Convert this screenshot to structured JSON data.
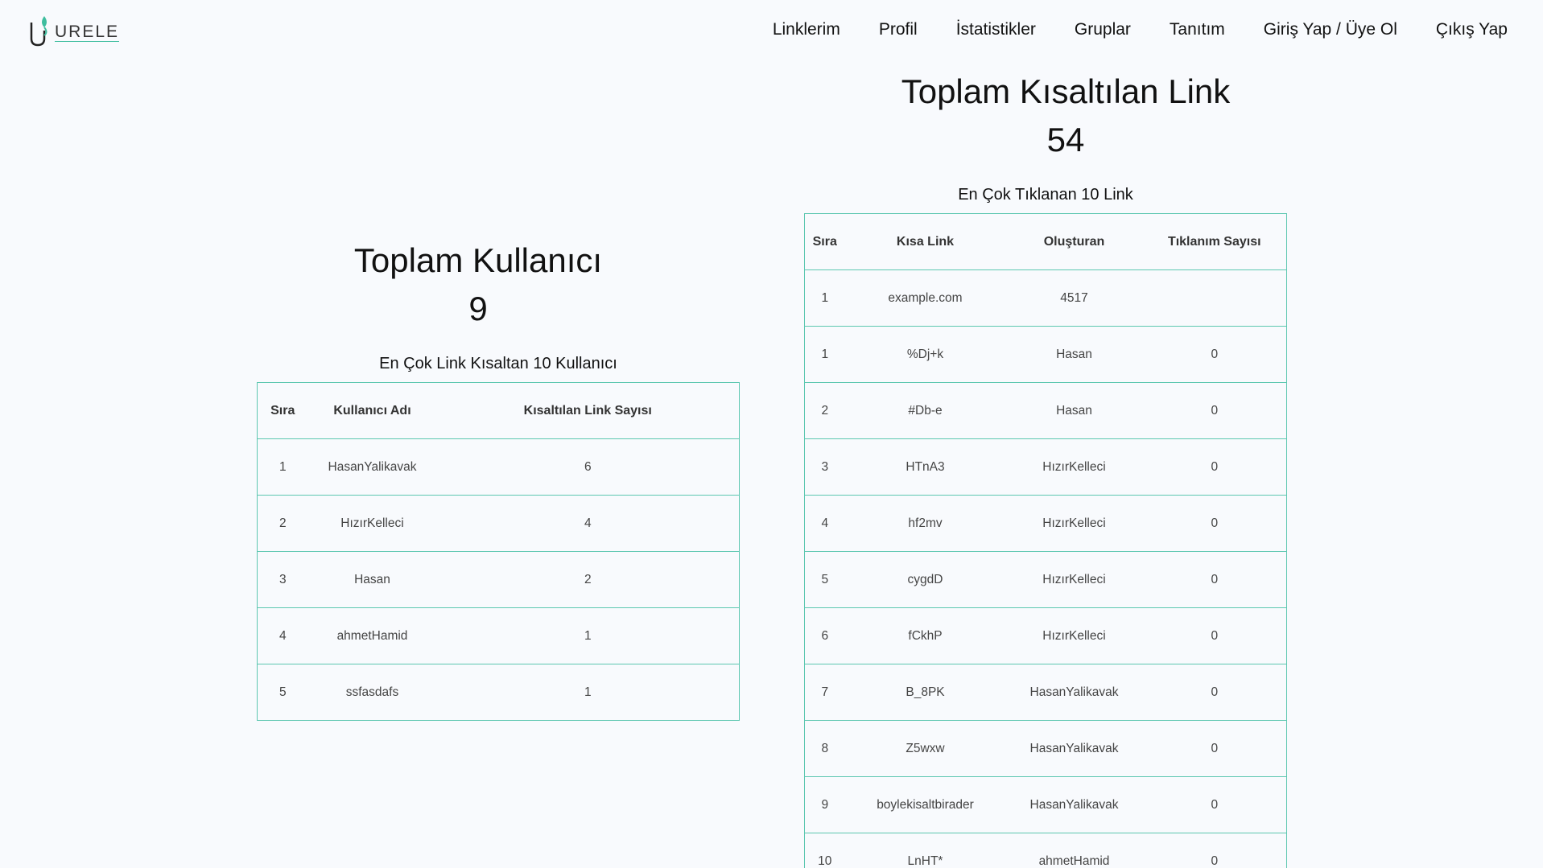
{
  "brand": {
    "name": "URELE",
    "accent": "#3dbd9e",
    "border": "#5cc7b0"
  },
  "nav": [
    {
      "label": "Linklerim"
    },
    {
      "label": "Profil"
    },
    {
      "label": "İstatistikler"
    },
    {
      "label": "Gruplar"
    },
    {
      "label": "Tanıtım"
    },
    {
      "label": "Giriş Yap / Üye Ol"
    },
    {
      "label": "Çıkış Yap"
    }
  ],
  "users": {
    "title": "Toplam Kullanıcı",
    "total": "9",
    "caption": "En Çok Link Kısaltan 10 Kullanıcı",
    "headers": [
      "Sıra",
      "Kullanıcı Adı",
      "Kısaltılan Link Sayısı"
    ],
    "rows": [
      [
        "1",
        "HasanYalikavak",
        "6"
      ],
      [
        "2",
        "HızırKelleci",
        "4"
      ],
      [
        "3",
        "Hasan",
        "2"
      ],
      [
        "4",
        "ahmetHamid",
        "1"
      ],
      [
        "5",
        "ssfasdafs",
        "1"
      ]
    ]
  },
  "links": {
    "title": "Toplam Kısaltılan Link",
    "total": "54",
    "caption": "En Çok Tıklanan 10 Link",
    "headers": [
      "Sıra",
      "Kısa Link",
      "Oluşturan",
      "Tıklanım Sayısı"
    ],
    "rows": [
      [
        "1",
        "example.com",
        "4517",
        ""
      ],
      [
        "1",
        "%Dj+k",
        "Hasan",
        "0"
      ],
      [
        "2",
        "#Db-e",
        "Hasan",
        "0"
      ],
      [
        "3",
        "HTnA3",
        "HızırKelleci",
        "0"
      ],
      [
        "4",
        "hf2mv",
        "HızırKelleci",
        "0"
      ],
      [
        "5",
        "cygdD",
        "HızırKelleci",
        "0"
      ],
      [
        "6",
        "fCkhP",
        "HızırKelleci",
        "0"
      ],
      [
        "7",
        "B_8PK",
        "HasanYalikavak",
        "0"
      ],
      [
        "8",
        "Z5wxw",
        "HasanYalikavak",
        "0"
      ],
      [
        "9",
        "boylekisaltbirader",
        "HasanYalikavak",
        "0"
      ],
      [
        "10",
        "LnHT*",
        "ahmetHamid",
        "0"
      ]
    ]
  }
}
